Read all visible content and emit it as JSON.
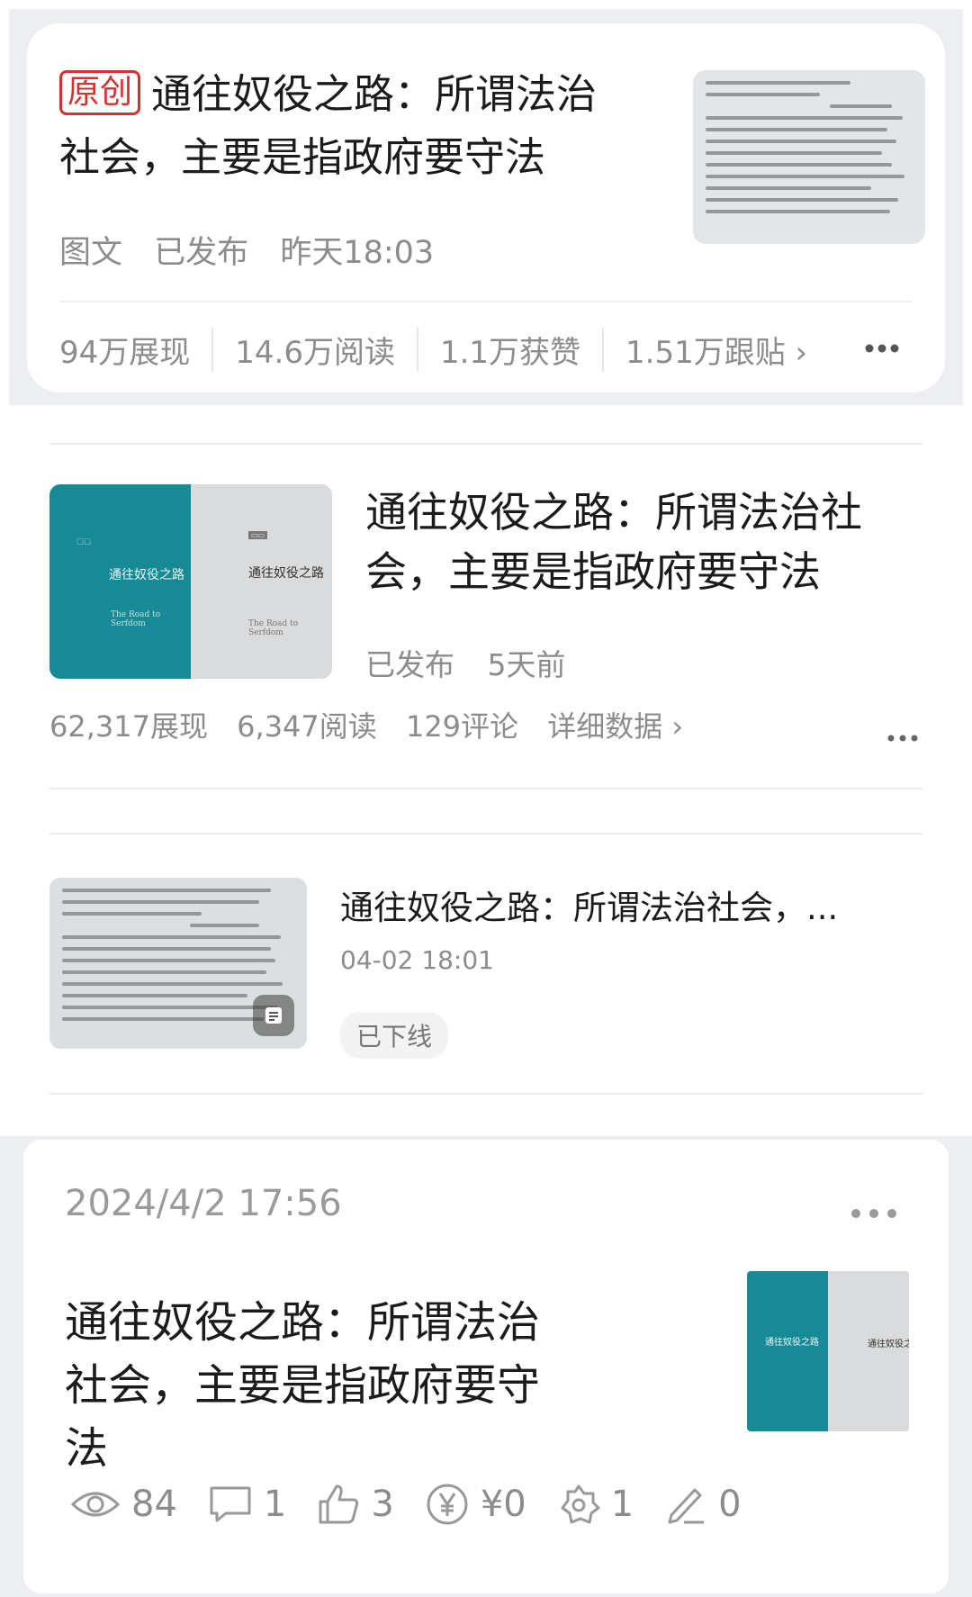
{
  "card1": {
    "badge": "原创",
    "title": "通往奴役之路：所谓法治社会，主要是指政府要守法",
    "meta": [
      "图文",
      "已发布",
      "昨天18:03"
    ],
    "stats": [
      "94万展现",
      "14.6万阅读",
      "1.1万获赞",
      "1.51万跟贴 ›"
    ]
  },
  "card2": {
    "title": "通往奴役之路：所谓法治社会，主要是指政府要守法",
    "meta": [
      "已发布",
      "5天前"
    ],
    "stats": [
      "62,317展现",
      "6,347阅读",
      "129评论",
      "详细数据 ›"
    ],
    "book_title": "通往奴役之路",
    "book_en": "The Road to Serfdom"
  },
  "card3": {
    "title": "通往奴役之路：所谓法治社会，...",
    "date": "04-02 18:01",
    "status": "已下线"
  },
  "card4": {
    "date": "2024/4/2 17:56",
    "title": "通往奴役之路：所谓法治社会，主要是指政府要守法",
    "stats": {
      "views": "84",
      "comments": "1",
      "likes": "3",
      "income": "¥0",
      "favorites": "1",
      "edits": "0"
    }
  },
  "icons": {
    "more": "more-dots-icon",
    "views": "eye-icon",
    "comments": "comment-icon",
    "likes": "thumbs-up-icon",
    "income": "yen-icon",
    "favorites": "star-icon",
    "edits": "pen-icon"
  },
  "colors": {
    "badge_red": "#d4322f",
    "book_teal": "#178a96"
  }
}
